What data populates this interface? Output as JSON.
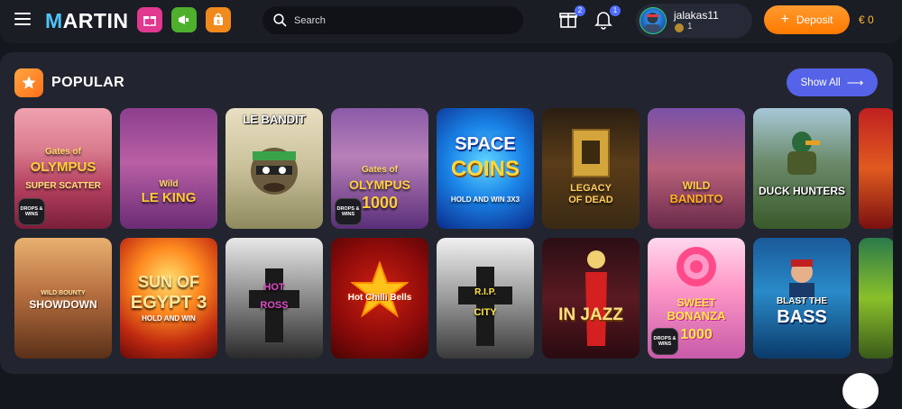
{
  "header": {
    "logo_text": "MARTIN",
    "search_placeholder": "Search",
    "gifts_badge": "2",
    "notifications_badge": "1",
    "username": "jalakas11",
    "level": "1",
    "deposit_label": "Deposit",
    "balance": "€ 0"
  },
  "section": {
    "title": "POPULAR",
    "show_all_label": "Show All"
  },
  "games_row1": [
    {
      "line1": "Gates of",
      "line2": "OLYMPUS",
      "sub": "SUPER SCATTER",
      "drops": true
    },
    {
      "line1": "Wild",
      "line2": "LE KING",
      "sub": "",
      "drops": false
    },
    {
      "line1": "LE BANDIT",
      "line2": "",
      "sub": "",
      "drops": false
    },
    {
      "line1": "Gates of",
      "line2": "OLYMPUS",
      "sub": "1000",
      "drops": true
    },
    {
      "line1": "SPACE",
      "line2": "COINS",
      "sub": "HOLD AND WIN 3X3",
      "drops": false
    },
    {
      "line1": "LEGACY",
      "line2": "OF DEAD",
      "sub": "",
      "drops": false
    },
    {
      "line1": "WILD",
      "line2": "BANDITO",
      "sub": "",
      "drops": false
    },
    {
      "line1": "DUCK HUNTERS",
      "line2": "",
      "sub": "",
      "drops": false
    }
  ],
  "games_row2": [
    {
      "line1": "WILD BOUNTY",
      "line2": "SHOWDOWN",
      "sub": "",
      "drops": false
    },
    {
      "line1": "SUN OF",
      "line2": "EGYPT 3",
      "sub": "HOLD AND WIN",
      "drops": false
    },
    {
      "line1": "HOT",
      "line2": "ROSS",
      "sub": "",
      "drops": false
    },
    {
      "line1": "Hot Chilli Bells",
      "line2": "",
      "sub": "",
      "drops": false
    },
    {
      "line1": "R.I.P.",
      "line2": "CITY",
      "sub": "",
      "drops": false
    },
    {
      "line1": "IN JAZZ",
      "line2": "",
      "sub": "",
      "drops": false
    },
    {
      "line1": "SWEET",
      "line2": "BONANZA",
      "sub": "1000",
      "drops": true
    },
    {
      "line1": "BLAST THE",
      "line2": "BASS",
      "sub": "",
      "drops": false
    }
  ],
  "drops_label": "DROPS & WINS",
  "colors": {
    "accent_orange": "#ff8a1a",
    "accent_blue": "#5563e8",
    "panel": "#22252f",
    "background": "#15171e"
  }
}
